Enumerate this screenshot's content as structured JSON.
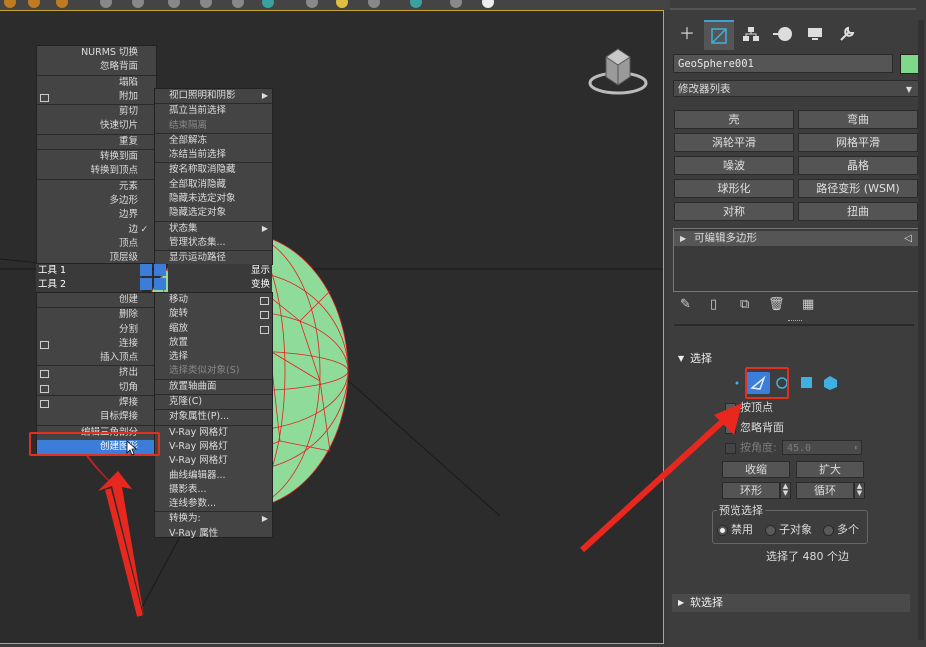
{
  "viewport": {
    "object_color": "#8fdc9a",
    "wire_color": "#e02020"
  },
  "quad_left": {
    "items": [
      {
        "label": "NURMS 切换"
      },
      {
        "label": "忽略背面"
      },
      {
        "label": "塌陷",
        "sep": true
      },
      {
        "label": "附加",
        "icon": true
      },
      {
        "label": "剪切",
        "sep": true
      },
      {
        "label": "快速切片"
      },
      {
        "label": "重复",
        "sep": true
      },
      {
        "label": "转换到面",
        "sep": true
      },
      {
        "label": "转换到顶点"
      },
      {
        "label": "元素",
        "sep": true
      },
      {
        "label": "多边形"
      },
      {
        "label": "边界"
      },
      {
        "label": "边",
        "check": true
      },
      {
        "label": "顶点"
      },
      {
        "label": "顶层级"
      }
    ],
    "tool1": "工具 1",
    "tool2": "工具 2",
    "display": "显示",
    "transform": "变换",
    "bottom_items": [
      {
        "label": "创建"
      },
      {
        "label": "删除",
        "sep": true
      },
      {
        "label": "分割"
      },
      {
        "label": "连接",
        "icon": true
      },
      {
        "label": "插入顶点"
      },
      {
        "label": "挤出",
        "icon": true,
        "sep": true
      },
      {
        "label": "切角",
        "icon": true
      },
      {
        "label": "焊接",
        "icon": true,
        "sep": true
      },
      {
        "label": "目标焊接"
      },
      {
        "label": "编辑三角剖分",
        "sep": true
      },
      {
        "label": "创建图形",
        "highlight": true
      }
    ]
  },
  "quad_right": {
    "items": [
      {
        "label": "视口照明和阴影",
        "arrow": true
      },
      {
        "label": "孤立当前选择",
        "sep": true
      },
      {
        "label": "结束隔离",
        "disabled": true
      },
      {
        "label": "全部解冻",
        "sep": true
      },
      {
        "label": "冻结当前选择"
      },
      {
        "label": "按名称取消隐藏",
        "sep": true
      },
      {
        "label": "全部取消隐藏"
      },
      {
        "label": "隐藏未选定对象"
      },
      {
        "label": "隐藏选定对象"
      },
      {
        "label": "状态集",
        "arrow": true,
        "sep": true
      },
      {
        "label": "管理状态集..."
      },
      {
        "label": "显示运动路径",
        "sep": true
      }
    ],
    "bottom_items": [
      {
        "label": "移动",
        "icon": true
      },
      {
        "label": "旋转",
        "icon": true
      },
      {
        "label": "缩放",
        "icon": true
      },
      {
        "label": "放置"
      },
      {
        "label": "选择"
      },
      {
        "label": "选择类似对象(S)",
        "disabled": true
      },
      {
        "label": "放置轴曲面",
        "sep": true
      },
      {
        "label": "克隆(C)",
        "sep": true
      },
      {
        "label": "对象属性(P)...",
        "sep": true
      },
      {
        "label": "V-Ray 网格灯",
        "sep": true
      },
      {
        "label": "V-Ray 网格灯"
      },
      {
        "label": "V-Ray 网格灯"
      },
      {
        "label": "曲线编辑器..."
      },
      {
        "label": "摄影表..."
      },
      {
        "label": "连线参数..."
      },
      {
        "label": "转换为:",
        "arrow": true,
        "sep": true
      },
      {
        "label": "V-Ray 属性"
      }
    ]
  },
  "panel": {
    "object_name": "GeoSphere001",
    "object_color": "#7ed98a",
    "modifier_list": "修改器列表",
    "modifier_buttons": [
      "壳",
      "弯曲",
      "涡轮平滑",
      "网格平滑",
      "噪波",
      "晶格",
      "球形化",
      "路径变形 (WSM)",
      "对称",
      "扭曲"
    ],
    "stack_item": "可编辑多边形",
    "selection_rollout": "选择",
    "by_vertex": "按顶点",
    "ignore_backfacing": "忽略背面",
    "by_angle": "按角度:",
    "angle_value": "45.0",
    "shrink": "收缩",
    "grow": "扩大",
    "ring": "环形",
    "loop": "循环",
    "preview_title": "预览选择",
    "preview_off": "禁用",
    "preview_subobj": "子对象",
    "preview_multi": "多个",
    "selected_text": "选择了 480 个边",
    "soft_selection": "软选择",
    "accent_color": "#3b7dd8"
  }
}
